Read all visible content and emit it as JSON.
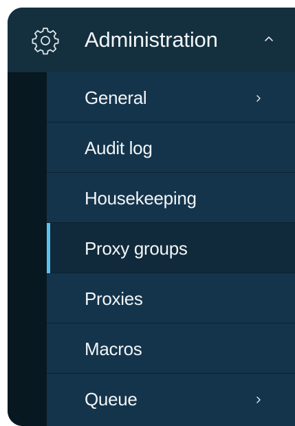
{
  "menu": {
    "title": "Administration",
    "icon": "gear-icon",
    "expanded_icon": "chevron-up-icon",
    "items": [
      {
        "label": "General",
        "has_submenu": true,
        "active": false
      },
      {
        "label": "Audit log",
        "has_submenu": false,
        "active": false
      },
      {
        "label": "Housekeeping",
        "has_submenu": false,
        "active": false
      },
      {
        "label": "Proxy groups",
        "has_submenu": false,
        "active": true
      },
      {
        "label": "Proxies",
        "has_submenu": false,
        "active": false
      },
      {
        "label": "Macros",
        "has_submenu": false,
        "active": false
      },
      {
        "label": "Queue",
        "has_submenu": true,
        "active": false
      }
    ]
  },
  "colors": {
    "header_bg": "#14303f",
    "item_bg": "#14344b",
    "active_bg": "#102a3b",
    "accent": "#5cc2f2",
    "text": "#f2f5f7"
  }
}
